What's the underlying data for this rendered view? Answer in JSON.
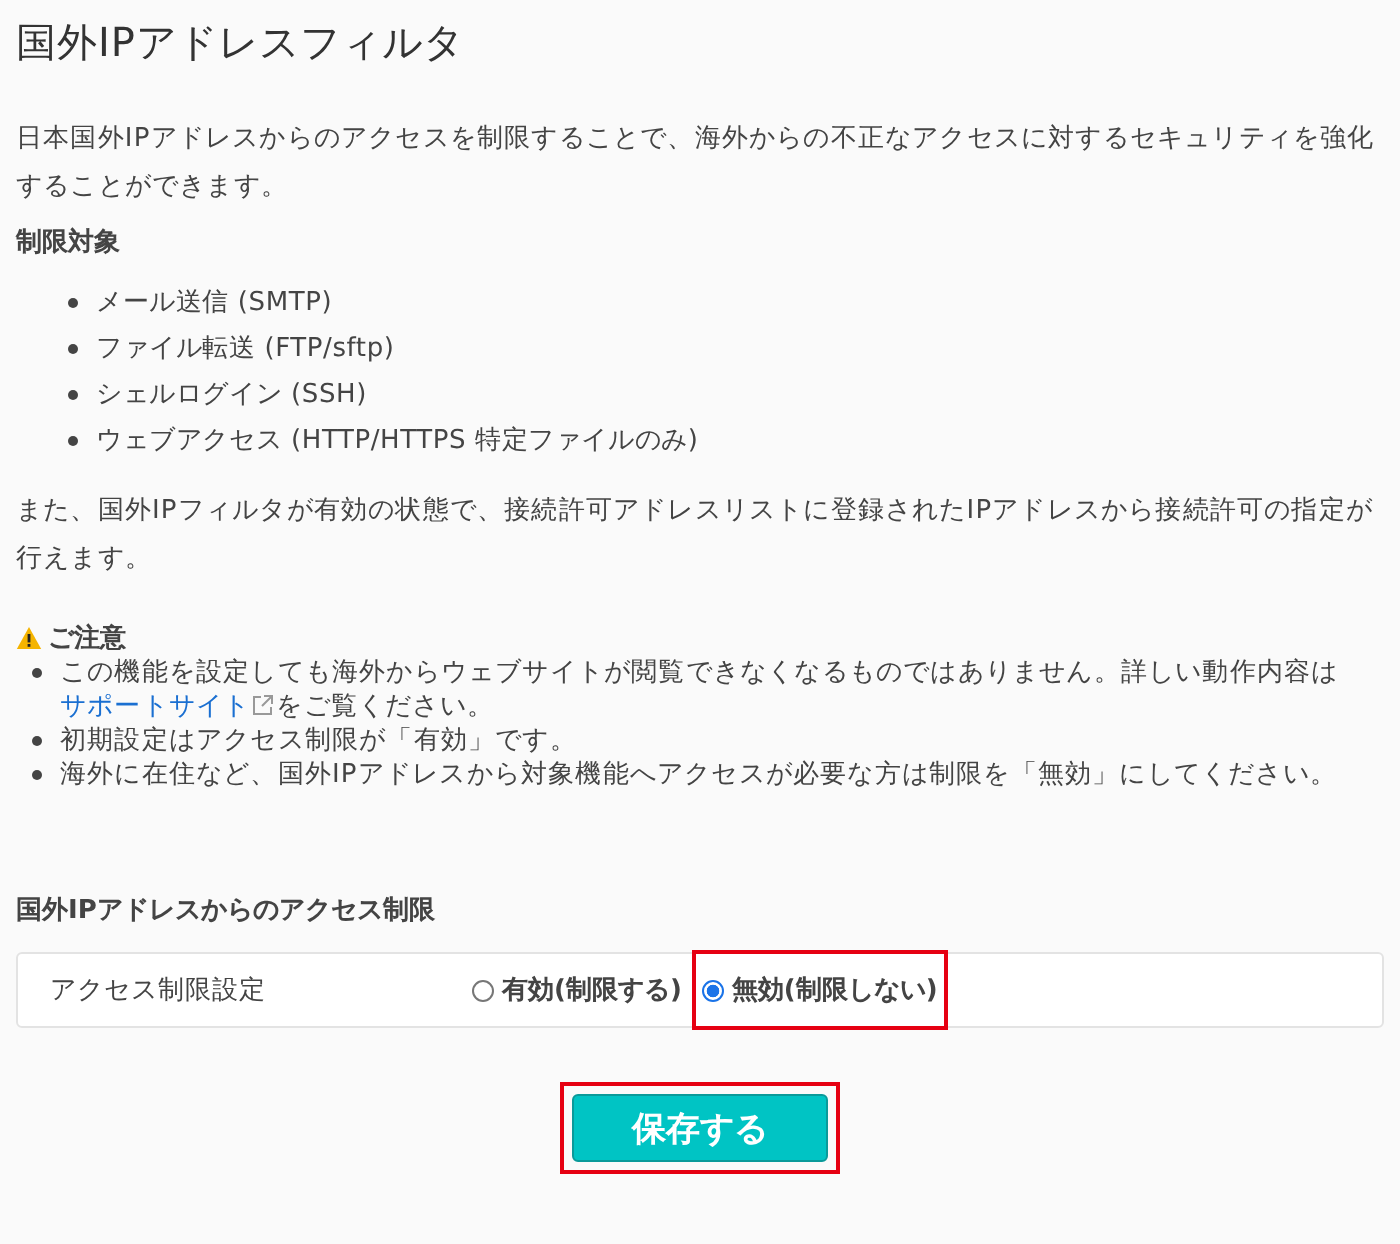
{
  "title": "国外IPアドレスフィルタ",
  "description": "日本国外IPアドレスからのアクセスを制限することで、海外からの不正なアクセスに対するセキュリティを強化することができます。",
  "targets_heading": "制限対象",
  "targets": [
    "メール送信 (SMTP)",
    "ファイル転送 (FTP/sftp)",
    "シェルログイン (SSH)",
    "ウェブアクセス (HTTP/HTTPS 特定ファイルのみ)"
  ],
  "allowlist_note": "また、国外IPフィルタが有効の状態で、接続許可アドレスリストに登録されたIPアドレスから接続許可の指定が行えます。",
  "caution": {
    "heading": "ご注意",
    "items": [
      {
        "text": "この機能を設定しても海外からウェブサイトが閲覧できなくなるものではありません。詳しい動作内容は",
        "link": "サポートサイト",
        "text_after": "をご覧ください。"
      },
      {
        "text": "初期設定はアクセス制限が「有効」です。"
      },
      {
        "text": "海外に在住など、国外IPアドレスから対象機能へアクセスが必要な方は制限を「無効」にしてください。"
      }
    ]
  },
  "setting_section": {
    "heading": "国外IPアドレスからのアクセス制限",
    "label": "アクセス制限設定",
    "options": [
      {
        "label": "有効(制限する)",
        "selected": false,
        "highlighted": false
      },
      {
        "label": "無効(制限しない)",
        "selected": true,
        "highlighted": true
      }
    ]
  },
  "save_button": {
    "label": "保存する",
    "highlighted": true
  }
}
